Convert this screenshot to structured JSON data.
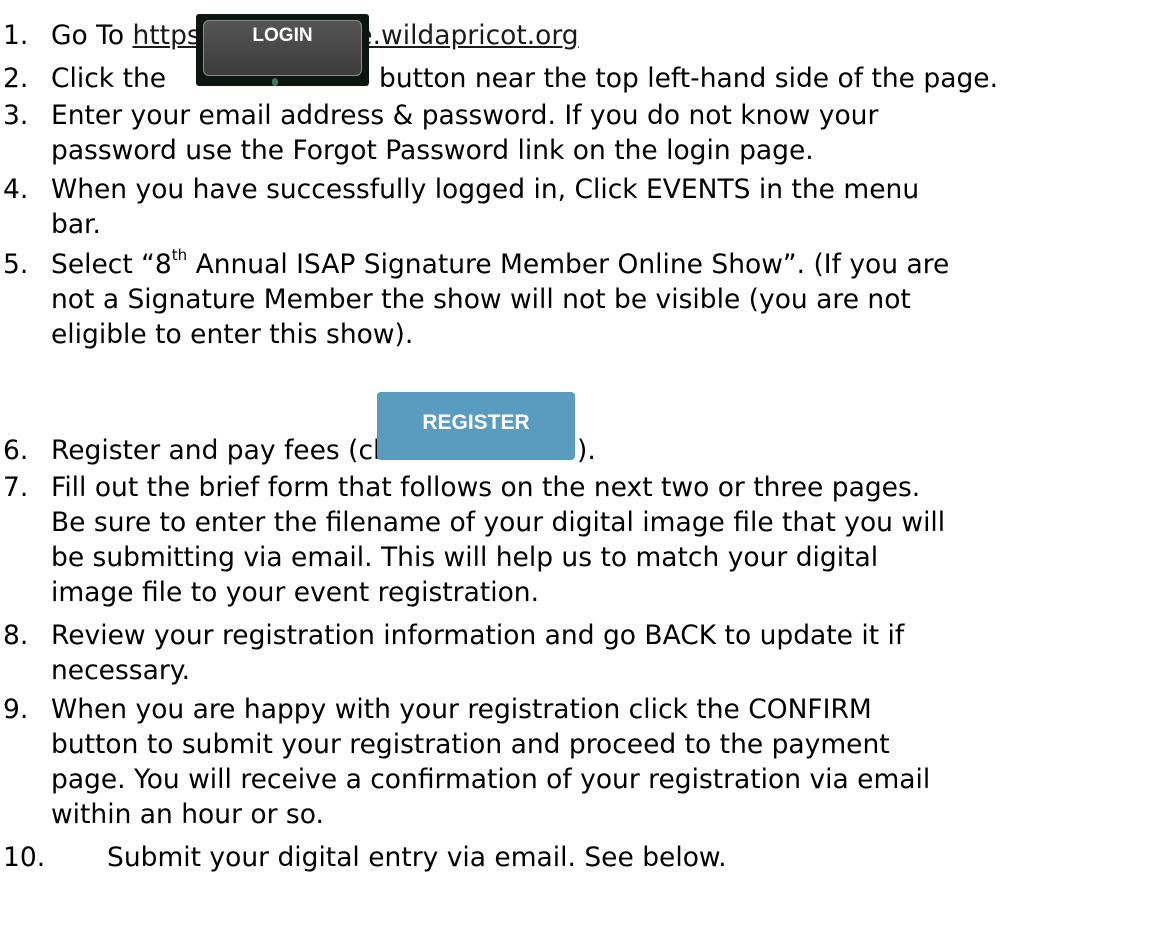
{
  "steps": [
    {
      "num": "1.",
      "lines": [
        "Go To "
      ],
      "link": "https://isap-online.wildapricot.org"
    },
    {
      "num": "2.",
      "before": "Click the ",
      "after": " button near the top left-hand side of the page."
    },
    {
      "num": "3.",
      "lines": [
        "Enter your email address & password. If you do not know your",
        "password use the Forgot Password link on the login page."
      ]
    },
    {
      "num": "4.",
      "lines": [
        "When you have successfully logged in, Click EVENTS in the menu",
        "bar."
      ]
    },
    {
      "num": "5.",
      "pre": "Select “8",
      "sup": "th",
      "post": " Annual ISAP Signature Member Online Show”. (If you are",
      "lines": [
        "not a Signature Member the show will not be visible (you are not",
        "eligible to enter this show)."
      ]
    },
    {
      "num": "6.",
      "before": "Register and pay fees (click ",
      "after": ")."
    },
    {
      "num": "7.",
      "lines": [
        "Fill out the brief form that follows on the next two or three pages.",
        "Be sure to enter the filename of your digital image file that you will",
        "be submitting via email. This will help us to match your digital",
        "image file to your event registration."
      ]
    },
    {
      "num": "8.",
      "lines": [
        "Review your registration information and go BACK to update it if",
        "necessary."
      ]
    },
    {
      "num": "9.",
      "lines": [
        "When you are happy with your registration click the CONFIRM",
        "button to submit your registration and proceed to the payment",
        "page. You will receive a confirmation of your registration via email",
        "within an hour or so."
      ]
    },
    {
      "num": "10.",
      "lines": [
        "Submit your digital entry via email. See below."
      ]
    }
  ],
  "buttons": {
    "login_label": "LOGIN",
    "register_label": "REGISTER"
  },
  "colors": {
    "register_button": "#5a9bc0",
    "login_button": "#4a4a4a"
  }
}
